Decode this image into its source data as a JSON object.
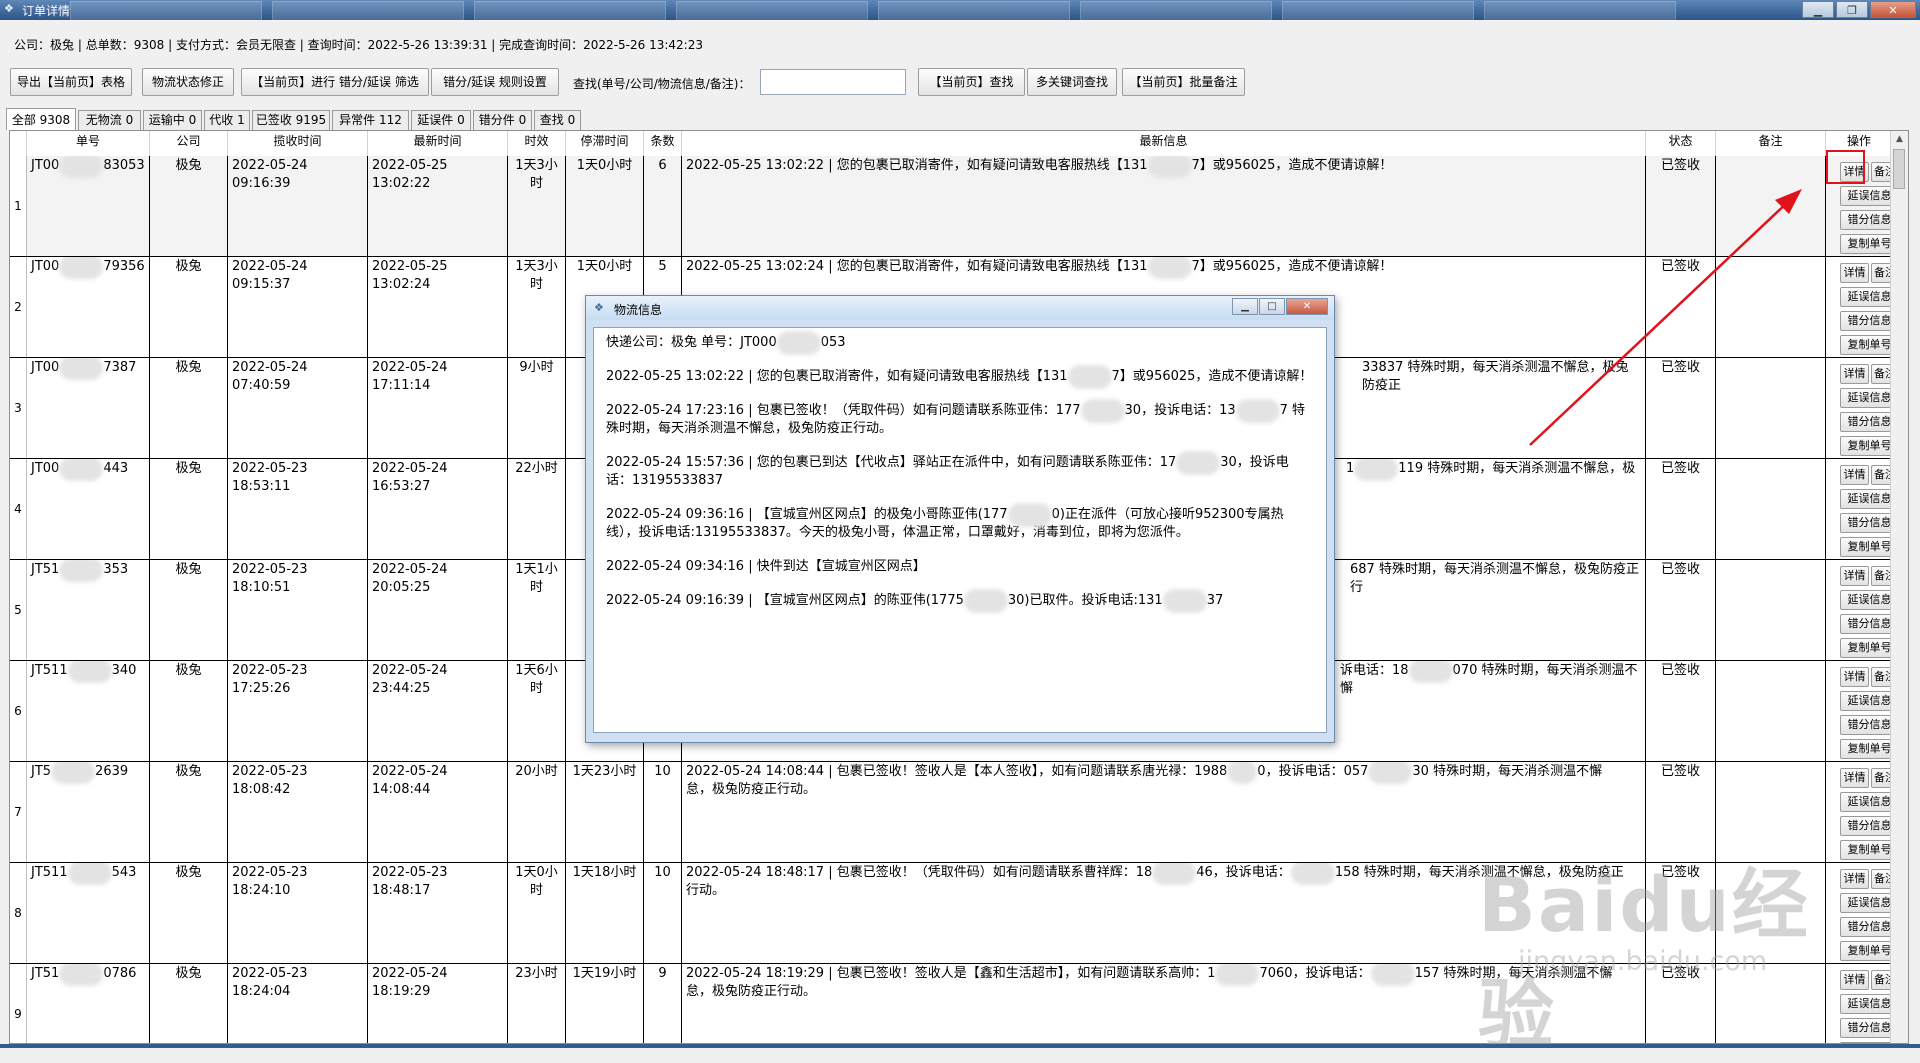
{
  "window": {
    "title": "订单详情"
  },
  "info": {
    "company_label": "公司：",
    "company": "极兔",
    "total_label": "总单数：",
    "total": "9308",
    "pay_label": "支付方式：",
    "pay": "会员无限查",
    "query_time_label": "查询时间：",
    "query_time": "2022-5-26 13:39:31",
    "done_time_label": "完成查询时间：",
    "done_time": "2022-5-26 13:42:23"
  },
  "toolbar": {
    "export": "导出【当前页】表格",
    "fix_status": "物流状态修正",
    "filter": "【当前页】进行 错分/延误 筛选",
    "rules": "错分/延误 规则设置",
    "search_label": "查找(单号/公司/物流信息/备注)：",
    "search_value": "",
    "find": "【当前页】查找",
    "multi_find": "多关键词查找",
    "batch_note": "【当前页】批量备注"
  },
  "tabs": [
    {
      "label": "全部 9308",
      "active": true
    },
    {
      "label": "无物流 0",
      "active": false
    },
    {
      "label": "运输中 0",
      "active": false
    },
    {
      "label": "代收 1",
      "active": false
    },
    {
      "label": "已签收 9195",
      "active": false
    },
    {
      "label": "异常件 112",
      "active": false
    },
    {
      "label": "延误件 0",
      "active": false
    },
    {
      "label": "错分件 0",
      "active": false
    },
    {
      "label": "查找 0",
      "active": false
    }
  ],
  "columns": [
    "单号",
    "公司",
    "揽收时间",
    "最新时间",
    "时效",
    "停滞时间",
    "条数",
    "最新信息",
    "状态",
    "备注",
    "操作"
  ],
  "op_buttons": {
    "detail": "详情",
    "note": "备注",
    "delay": "延误信息",
    "mis": "错分信息",
    "copy": "复制单号"
  },
  "rows": [
    {
      "n": "1",
      "id_a": "JT00",
      "id_b": "83053",
      "company": "极兔",
      "pickup": "2022-05-24 09:16:39",
      "latest": "2022-05-25 13:02:22",
      "duration": "1天3小时",
      "stall": "1天0小时",
      "count": "6",
      "msg_a": "2022-05-25 13:02:22 | 您的包裹已取消寄件，如有疑问请致电客服热线【131",
      "msg_b": "7】或956025，造成不便请谅解！",
      "status": "已签收",
      "note": ""
    },
    {
      "n": "2",
      "id_a": "JT00",
      "id_b": "79356",
      "company": "极兔",
      "pickup": "2022-05-24 09:15:37",
      "latest": "2022-05-25 13:02:24",
      "duration": "1天3小时",
      "stall": "1天0小时",
      "count": "5",
      "msg_a": "2022-05-25 13:02:24 | 您的包裹已取消寄件，如有疑问请致电客服热线【131",
      "msg_b": "7】或956025，造成不便请谅解！",
      "status": "已签收",
      "note": ""
    },
    {
      "n": "3",
      "id_a": "JT00",
      "id_b": "7387",
      "company": "极兔",
      "pickup": "2022-05-24 07:40:59",
      "latest": "2022-05-24 17:11:14",
      "duration": "9小时",
      "stall": "1",
      "count": "",
      "msg_a": "",
      "msg_b": "33837 特殊时期，每天消杀测温不懈怠，极兔防疫正",
      "status": "已签收",
      "note": ""
    },
    {
      "n": "4",
      "id_a": "JT00",
      "id_b": "443",
      "company": "极兔",
      "pickup": "2022-05-23 18:53:11",
      "latest": "2022-05-24 16:53:27",
      "duration": "22小时",
      "stall": "1",
      "count": "",
      "msg_a": "1",
      "msg_b": "119  特殊时期，每天消杀测温不懈怠，极",
      "status": "已签收",
      "note": ""
    },
    {
      "n": "5",
      "id_a": "JT51",
      "id_b": "353",
      "company": "极兔",
      "pickup": "2022-05-23 18:10:51",
      "latest": "2022-05-24 20:05:25",
      "duration": "1天1小时",
      "stall": "1",
      "count": "",
      "msg_a": "",
      "msg_b": "687 特殊时期，每天消杀测温不懈怠，极兔防疫正行",
      "status": "已签收",
      "note": ""
    },
    {
      "n": "6",
      "id_a": "JT511",
      "id_b": "340",
      "company": "极兔",
      "pickup": "2022-05-23 17:25:26",
      "latest": "2022-05-24 23:44:25",
      "duration": "1天6小时",
      "stall": "1",
      "count": "",
      "msg_a": "诉电话：18",
      "msg_b": "070  特殊时期，每天消杀测温不懈",
      "status": "已签收",
      "note": ""
    },
    {
      "n": "7",
      "id_a": "JT5",
      "id_b": "2639",
      "company": "极兔",
      "pickup": "2022-05-23 18:08:42",
      "latest": "2022-05-24 14:08:44",
      "duration": "20小时",
      "stall": "1天23小时",
      "count": "10",
      "msg_a": "2022-05-24 14:08:44 | 包裹已签收！签收人是【本人签收】，如有问题请联系唐光禄：1988",
      "msg_b": "0，投诉电话：057",
      "msg_c": "30  特殊时期，每天消杀测温不懈",
      "msg_d": "怠，极兔防疫正行动。",
      "status": "已签收",
      "note": ""
    },
    {
      "n": "8",
      "id_a": "JT511",
      "id_b": "543",
      "company": "极兔",
      "pickup": "2022-05-23 18:24:10",
      "latest": "2022-05-23 18:48:17",
      "duration": "1天0小时",
      "stall": "1天18小时",
      "count": "10",
      "msg_a": "2022-05-24 18:48:17 | 包裹已签收！（凭取件码）如有问题请联系曹祥辉：18",
      "msg_b": "46，投诉电话：",
      "msg_c": "158 特殊时期，每天消杀测温不懈怠，极兔防疫正",
      "msg_d": "行动。",
      "status": "已签收",
      "note": ""
    },
    {
      "n": "9",
      "id_a": "JT51",
      "id_b": "0786",
      "company": "极兔",
      "pickup": "2022-05-23 18:24:04",
      "latest": "2022-05-24 18:19:29",
      "duration": "23小时",
      "stall": "1天19小时",
      "count": "9",
      "msg_a": "2022-05-24 18:19:29 | 包裹已签收！签收人是【鑫和生活超市】，如有问题请联系高帅：1",
      "msg_b": "7060，投诉电话：",
      "msg_c": "157  特殊时期，每天消杀测温不懈",
      "msg_d": "怠，极兔防疫正行动。",
      "status": "已签收",
      "note": ""
    }
  ],
  "dialog": {
    "title": "物流信息",
    "header_a": "快递公司：极兔    单号：JT000",
    "header_b": "053",
    "lines": [
      {
        "a": "2022-05-25 13:02:22 | 您的包裹已取消寄件，如有疑问请致电客服热线【131",
        "b": "7】或956025，造成不便请谅解！"
      },
      {
        "a": "2022-05-24 17:23:16 | 包裹已签收！（凭取件码）如有问题请联系陈亚伟：177",
        "b": "30，投诉电话：13",
        "c": "7 特殊时期，每天消杀测温不懈怠，极兔防疫正行动。"
      },
      {
        "a": "2022-05-24 15:57:36 | 您的包裹已到达【代收点】驿站正在派件中，如有问题请联系陈亚伟：17",
        "b": "30，投诉电话：13195533837"
      },
      {
        "a": "2022-05-24 09:36:16 | 【宣城宣州区网点】的极兔小哥陈亚伟(177",
        "b": "0)正在派件（可放心接听952300专属热线），投诉电话:13195533837。今天的极兔小哥，体温正常，口罩戴好，消毒到位，即将为您派件。"
      },
      {
        "a": "2022-05-24 09:34:16 | 快件到达【宣城宣州区网点】"
      },
      {
        "a": "2022-05-24 09:16:39 | 【宣城宣州区网点】的陈亚伟(1775",
        "b": "30)已取件。投诉电话:131",
        "c": "37"
      }
    ]
  },
  "watermark": {
    "brand": "Baidu经验",
    "site": "jingyan.baidu.com"
  },
  "colors": {
    "highlight": "#e0121c",
    "titlebar": "#3f679a"
  }
}
